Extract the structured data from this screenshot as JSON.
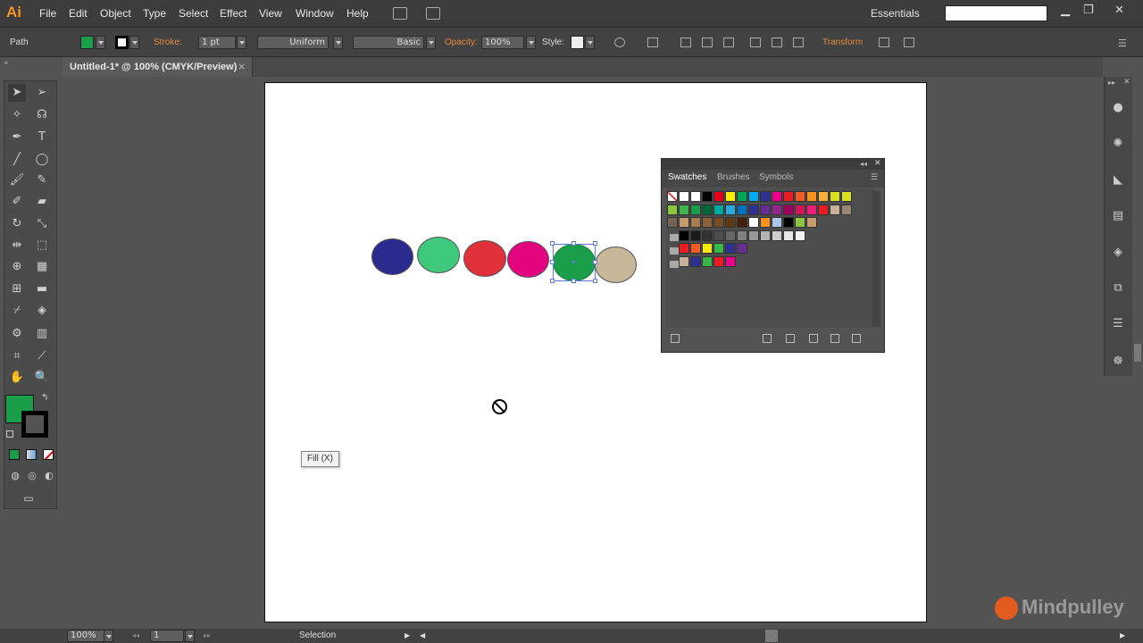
{
  "menubar": {
    "app_logo": "Ai",
    "items": [
      "File",
      "Edit",
      "Object",
      "Type",
      "Select",
      "Effect",
      "View",
      "Window",
      "Help"
    ],
    "workspace": "Essentials",
    "search_value": ""
  },
  "controlbar": {
    "object_type": "Path",
    "fill_color": "#1b9e4a",
    "stroke_label": "Stroke:",
    "stroke_weight": "1 pt",
    "stroke_profile": "Uniform",
    "brush": "Basic",
    "opacity_label": "Opacity:",
    "opacity_value": "100%",
    "style_label": "Style:",
    "transform_label": "Transform"
  },
  "document": {
    "tab_label": "Untitled-1* @ 100% (CMYK/Preview)",
    "tab_close": "×"
  },
  "canvas": {
    "objects": [
      {
        "name": "ellipse-navy",
        "color": "#2a2a8f"
      },
      {
        "name": "ellipse-mint",
        "color": "#3ec97c"
      },
      {
        "name": "ellipse-red",
        "color": "#e0313a"
      },
      {
        "name": "ellipse-magenta",
        "color": "#e5047f"
      },
      {
        "name": "ellipse-green",
        "color": "#1b9e4a",
        "selected": true
      },
      {
        "name": "ellipse-tan",
        "color": "#c8b89a"
      }
    ],
    "tooltip": "Fill (X)"
  },
  "swatches_panel": {
    "tabs": [
      "Swatches",
      "Brushes",
      "Symbols"
    ],
    "active_tab": "Swatches"
  },
  "statusbar": {
    "zoom": "100%",
    "artboard_number": "1",
    "status_text": "Selection"
  },
  "watermark": "Mindpulley"
}
